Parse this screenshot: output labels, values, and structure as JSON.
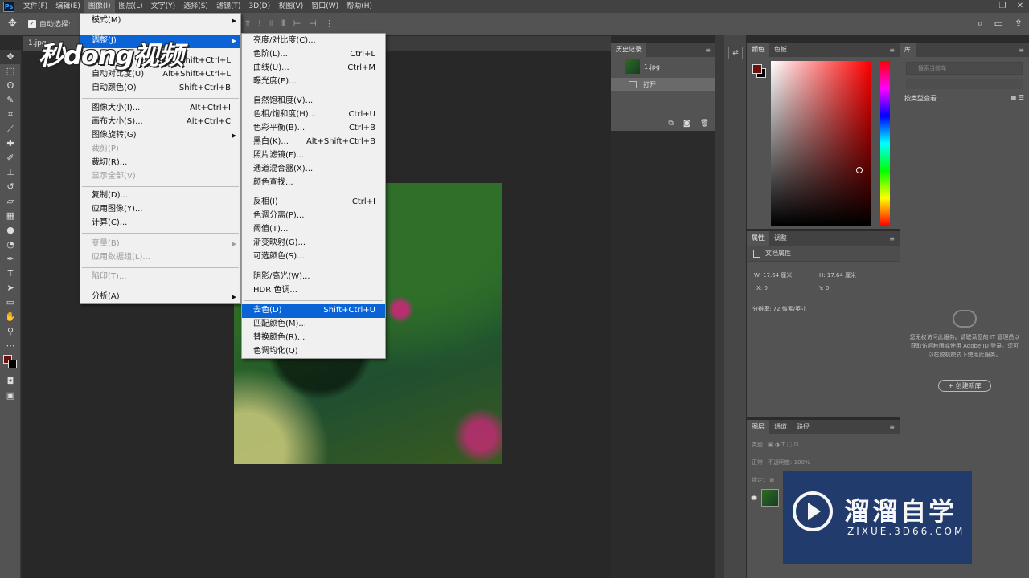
{
  "menubar": {
    "logo": "Ps",
    "items": [
      "文件(F)",
      "编辑(E)",
      "图像(I)",
      "图层(L)",
      "文字(Y)",
      "选择(S)",
      "滤镜(T)",
      "3D(D)",
      "视图(V)",
      "窗口(W)",
      "帮助(H)"
    ],
    "window_controls": [
      "–",
      "❐",
      "✕"
    ]
  },
  "options_bar": {
    "auto_select_label": "自动选择:"
  },
  "document": {
    "tab": "1.jpg"
  },
  "image_menu": {
    "mode": "模式(M)",
    "adjustments": "调整(J)",
    "auto_tone_shortcut": "Shift+Ctrl+L",
    "auto_contrast": "自动对比度(U)",
    "auto_contrast_shortcut": "Alt+Shift+Ctrl+L",
    "auto_color": "自动颜色(O)",
    "auto_color_shortcut": "Shift+Ctrl+B",
    "image_size": "图像大小(I)...",
    "image_size_shortcut": "Alt+Ctrl+I",
    "canvas_size": "画布大小(S)...",
    "canvas_size_shortcut": "Alt+Ctrl+C",
    "image_rotation": "图像旋转(G)",
    "crop": "裁剪(P)",
    "trim": "裁切(R)...",
    "reveal_all": "显示全部(V)",
    "duplicate": "复制(D)...",
    "apply_image": "应用图像(Y)...",
    "calculations": "计算(C)...",
    "variables": "变量(B)",
    "apply_data_set": "应用数据组(L)...",
    "trap": "陷印(T)...",
    "analysis": "分析(A)"
  },
  "adjust_menu": {
    "brightness_contrast": "亮度/对比度(C)...",
    "levels": "色阶(L)...",
    "levels_shortcut": "Ctrl+L",
    "curves": "曲线(U)...",
    "curves_shortcut": "Ctrl+M",
    "exposure": "曝光度(E)...",
    "vibrance": "自然饱和度(V)...",
    "hue_saturation": "色相/饱和度(H)...",
    "hue_saturation_shortcut": "Ctrl+U",
    "color_balance": "色彩平衡(B)...",
    "color_balance_shortcut": "Ctrl+B",
    "black_white": "黑白(K)...",
    "black_white_shortcut": "Alt+Shift+Ctrl+B",
    "photo_filter": "照片滤镜(F)...",
    "channel_mixer": "通道混合器(X)...",
    "color_lookup": "颜色查找...",
    "invert": "反相(I)",
    "invert_shortcut": "Ctrl+I",
    "posterize": "色调分离(P)...",
    "threshold": "阈值(T)...",
    "gradient_map": "渐变映射(G)...",
    "selective_color": "可选颜色(S)...",
    "shadows_highlights": "阴影/高光(W)...",
    "hdr_toning": "HDR 色调...",
    "desaturate": "去色(D)",
    "desaturate_shortcut": "Shift+Ctrl+U",
    "match_color": "匹配颜色(M)...",
    "replace_color": "替换颜色(R)...",
    "equalize": "色调均化(Q)"
  },
  "history_panel": {
    "tab": "历史记录",
    "snapshot": "1.jpg",
    "step": "打开"
  },
  "color_panel": {
    "tabs": [
      "颜色",
      "色板"
    ],
    "foreground": "#6b1010",
    "background": "#000000"
  },
  "properties_panel": {
    "tabs": [
      "属性",
      "调整"
    ],
    "doc_label": "文档属性",
    "width": "W:  17.64 厘米",
    "height": "H:  17.64 厘米",
    "x": "X:  0",
    "y": "Y:  0",
    "resolution": "分辨率: 72 像素/英寸"
  },
  "library_panel": {
    "tab": "库",
    "search_placeholder": "搜索当前库",
    "view_by": "按类型查看",
    "message": "您无权访问此服务。请联系您的 IT 管理员以获取访问权限或使用 Adobe ID 登录。您可以在脱机模式下使用此服务。",
    "create_button": "+ 创建新库"
  },
  "layers_panel": {
    "tabs": [
      "图层",
      "通道",
      "路径"
    ],
    "filter_label": "类型",
    "blend_mode": "正常",
    "opacity_label": "不透明度: 100%",
    "lock_label": "锁定:"
  },
  "watermarks": {
    "top_left": "秒dong视频",
    "brand_title": "溜溜自学",
    "brand_sub": "ZIXUE.3D66.COM"
  }
}
